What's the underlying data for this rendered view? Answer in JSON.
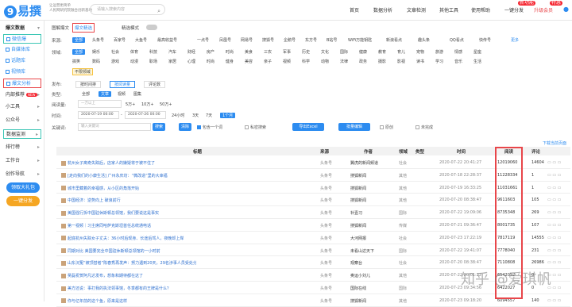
{
  "logo": {
    "text": "易撰",
    "mark": "9"
  },
  "slogan": [
    "让运营更简单",
    "人民网研究院融合创新基地"
  ],
  "search": {
    "placeholder": "请输入搜索内容"
  },
  "nav": {
    "items": [
      "首页",
      "数据分析",
      "文章检测",
      "其他工具",
      "使用帮助",
      "一键分发",
      "升级会员"
    ],
    "badge_fenfa": "新功能",
    "badge_vip": "特惠"
  },
  "sidebar": {
    "items": [
      {
        "label": "爆文数据",
        "type": "section"
      },
      {
        "label": "微信爆",
        "type": "sub",
        "boxed": "green"
      },
      {
        "label": "自媒体库",
        "type": "sub"
      },
      {
        "label": "话题库",
        "type": "sub"
      },
      {
        "label": "视频库",
        "type": "sub"
      },
      {
        "label": "爆文分析",
        "type": "sub",
        "boxed": "red"
      },
      {
        "label": "内部推荐",
        "type": "item",
        "badge": "NEW"
      },
      {
        "label": "小工具",
        "type": "item"
      },
      {
        "label": "公众号",
        "type": "item"
      },
      {
        "label": "数据监测",
        "type": "item",
        "boxed": "green"
      },
      {
        "label": "排行榜",
        "type": "item"
      },
      {
        "label": "工作台",
        "type": "item"
      },
      {
        "label": "创作导航",
        "type": "item"
      }
    ],
    "pill1": "领取大礼包",
    "pill2": "一键分发"
  },
  "tabs": {
    "t1": "图解爆文",
    "t2": "爆文精选",
    "mode": "精选模式"
  },
  "platform": {
    "label": "来源:",
    "items": [
      "全部",
      "头条号",
      "百家号",
      "大鱼号",
      "最高收益号",
      "一点号",
      "凤凰号",
      "网易号",
      "搜狐号",
      "企鹅号",
      "东方号",
      "B站号",
      "WiFi万能钥匙",
      "新浪看点",
      "趣头条",
      "QQ看点",
      "快传号",
      "更多"
    ]
  },
  "domain": {
    "label": "领域:",
    "row1": [
      "全部",
      "娱乐",
      "社会",
      "体育",
      "科技",
      "汽车",
      "财经",
      "房产",
      "时尚",
      "美食",
      "三农",
      "军事",
      "历史",
      "文化",
      "国际",
      "健康",
      "教育",
      "育儿",
      "宠物",
      "旅游",
      "情感",
      "星座"
    ],
    "row2": [
      "搞笑",
      "数码",
      "游戏",
      "动漫",
      "职场",
      "家居",
      "心理",
      "时尚",
      "健身",
      "美容",
      "亲子",
      "视频",
      "科学",
      "动物",
      "法律",
      "政务",
      "摄影",
      "影视",
      "读书",
      "学习",
      "音乐",
      "生活"
    ],
    "row3": [
      "不限领域"
    ]
  },
  "filters": {
    "pub_label": "发布:",
    "pub_opts": [
      "按时间排",
      "按阅读量",
      "评论数"
    ],
    "type_label": "类型:",
    "type_opts": [
      "全部",
      "文章",
      "视频",
      "图集"
    ],
    "read_label": "阅读量:",
    "read_opts": [
      "一万以上",
      "5万+",
      "10万+",
      "50万+"
    ],
    "time_label": "时间:",
    "date_from": "2020-07-19 00:00",
    "date_to": "2020-07-26 00:00",
    "time_opts": [
      "24小时",
      "3天",
      "7天",
      "1个月"
    ],
    "kw_label": "关键词:",
    "kw_placeholder": "输入关键词",
    "btn_search": "搜索",
    "btn_clear": "清除",
    "chk1": "包含一个词",
    "chk2": "私密搜索",
    "btn_export": "导出Excel",
    "btn_batch": "批量编辑",
    "chk3": "原创",
    "chk4": "未完成"
  },
  "download": "下载当前页面",
  "table": {
    "headers": [
      "标题",
      "来源",
      "作者",
      "领域",
      "类型",
      "时间",
      "阅读",
      "评论"
    ],
    "rows": [
      [
        "杭州女子离奇失踪后，店家人的嫌疑将于被不住了",
        "头条号",
        "翼虎的新闻频道",
        "社会",
        "",
        "2020-07-22 20:41:27",
        "12019060",
        "14604"
      ],
      [
        "[走向我们的小康生活] 广州永庆坊：“微改造”里的大幸福",
        "头条号",
        "搜狐新闻",
        "其他",
        "",
        "2020-07-18 22:28:37",
        "11228334",
        "1"
      ],
      [
        "城市里藏着的幸福感，从小区的角落开始",
        "头条号",
        "搜狐新闻",
        "其他",
        "",
        "2020-07-19 16:33:25",
        "11031661",
        "1"
      ],
      [
        "中国经济：逆势向上 破浪前行",
        "头条号",
        "搜狐新闻",
        "其他",
        "",
        "2020-07-20 08:38:47",
        "9611603",
        "105"
      ],
      [
        "美国强行拆中国驻休斯顿总领馆，我们要说这是事实",
        "头条号",
        "补壹习",
        "国际",
        "",
        "2020-07-22 19:09:06",
        "8735348",
        "269"
      ],
      [
        "第一视频｜习主席同哈萨克斯坦首任总统通电话",
        "头条号",
        "搜狐新闻",
        "传媒",
        "",
        "2020-07-21 09:36:47",
        "8001735",
        "107"
      ],
      [
        "起底杭州失踪女子丈夫：36小时后现身、长途后驾人，夜晚却上岸",
        "头条号",
        "大河网报",
        "社会",
        "",
        "2020-07-23 17:22:19",
        "7817119",
        "14555"
      ],
      [
        "同期对比 美国要完全中国驻休斯顿总领馆的一小时前",
        "头条号",
        "未看山达天下",
        "国际",
        "",
        "2020-07-22 19:41:07",
        "7778040",
        "231"
      ],
      [
        "山东沉冤“被顶替者”陈春秀再发声：努力遇到20天，29名涉事人员受处分",
        "头条号",
        "观察台",
        "社会",
        "",
        "2020-07-20 08:38:47",
        "7110808",
        "26986"
      ],
      [
        "吴磊祝贺阿凡达发布，想象和期待都在这了",
        "头条号",
        "奥运小刘儿",
        "其他",
        "",
        "2020-07-22 20:01:22",
        "6542052",
        "0"
      ],
      [
        "美方还说：事打我的执法领事馆，冬季都有的王牌是什么？",
        "头条号",
        "国际在线",
        "国际",
        "",
        "2020-07-23 09:34:56",
        "6422027",
        "0"
      ],
      [
        "你与亿年前的这个鱼，原来是这样",
        "头条号",
        "搜狐新闻",
        "其他",
        "",
        "2020-07-23 09:18:20",
        "6094557",
        "140"
      ]
    ]
  },
  "watermark": "知乎 @爱琪帆"
}
